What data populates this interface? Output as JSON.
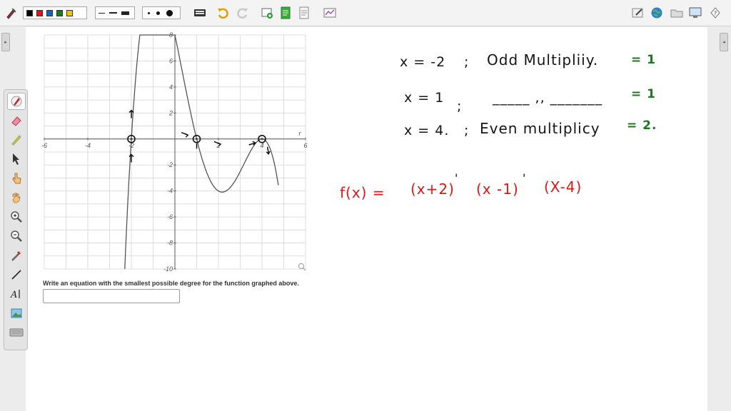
{
  "toolbar": {
    "colors": [
      "#000000",
      "#e01616",
      "#1565c0",
      "#1a7a1a",
      "#f2c200"
    ]
  },
  "graph": {
    "x_ticks": [
      "-6",
      "-4",
      "-2",
      "2",
      "4",
      "6"
    ],
    "y_ticks": [
      "8",
      "6",
      "4",
      "2",
      "-2",
      "-4",
      "-6",
      "-8",
      "-10"
    ],
    "x_axis_label": "r"
  },
  "question": {
    "text": "Write an equation with the smallest possible degree for the function graphed above.",
    "answer_value": ""
  },
  "notes": {
    "row1_root": "x = -2",
    "row1_sep": ";",
    "row1_desc": "Odd Multipliiy.",
    "row1_value": "= 1",
    "row2_root": "x = 1",
    "row2_sep": ";",
    "row2_desc": "_____ ,, _______",
    "row2_value": "= 1",
    "row3_root": "x = 4.",
    "row3_sep": ";",
    "row3_desc": "Even multiplicy",
    "row3_value": "= 2."
  },
  "equation": {
    "lhs": "f(x) =",
    "factor1": "(x+2)",
    "exp1": "'",
    "factor2": "(x -1)",
    "exp2": "'",
    "factor3": "(X-4)"
  }
}
